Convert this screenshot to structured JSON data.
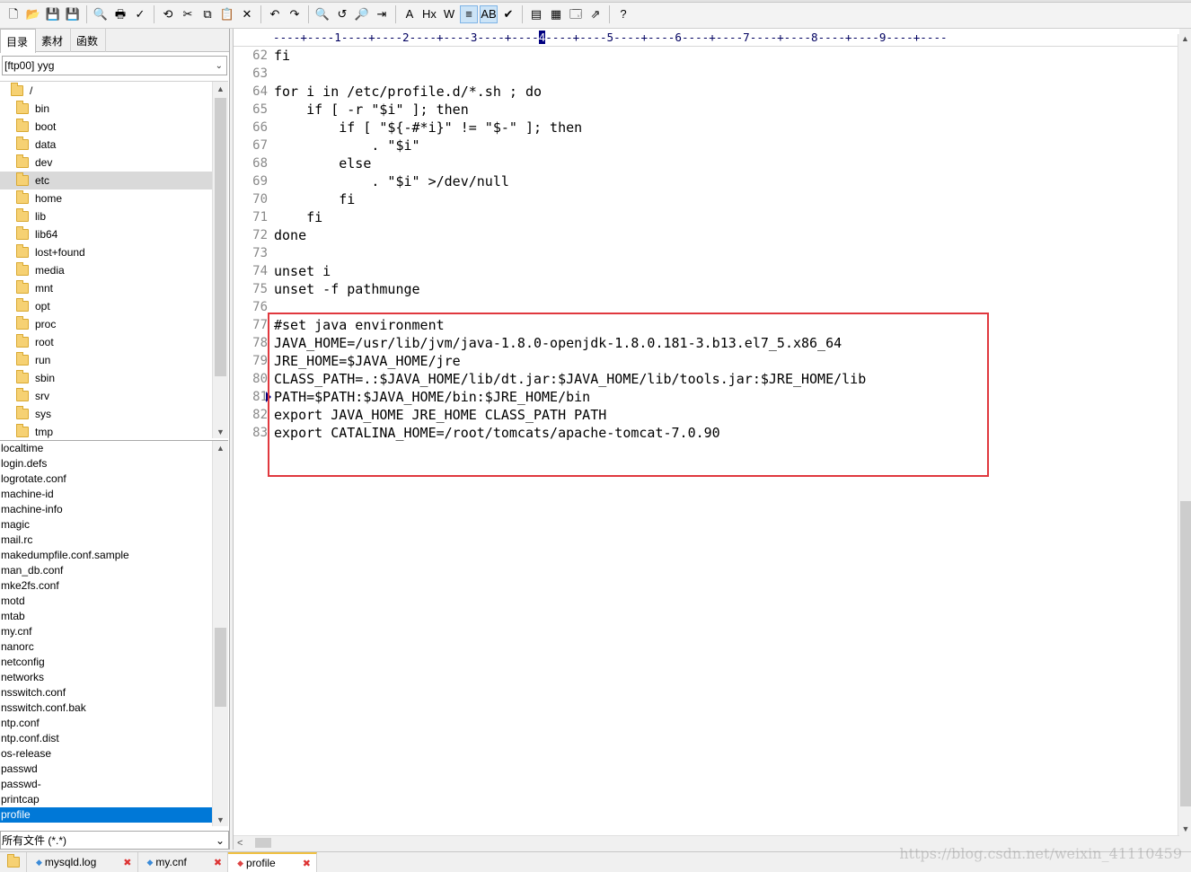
{
  "toolbar": {
    "icons": [
      "new-file-icon",
      "open-folder-icon",
      "save-icon",
      "save-all-icon",
      "print-preview-icon",
      "print-icon",
      "spell-check-icon",
      "format-icon",
      "cut-icon",
      "copy-icon",
      "paste-icon",
      "delete-icon",
      "undo-icon",
      "redo-icon",
      "find-icon",
      "replace-icon",
      "find-in-files-icon",
      "goto-icon",
      "font-icon",
      "hex-icon",
      "word-wrap-icon",
      "column-mode-icon",
      "abc-sort-icon",
      "check-icon",
      "view-icon",
      "layout-icon",
      "window-icon",
      "maximize-icon",
      "help-icon"
    ],
    "glyphs": [
      "🗋",
      "📂",
      "💾",
      "💾",
      "🔍",
      "🖶",
      "✓",
      "⟲",
      "✂",
      "⧉",
      "📋",
      "✕",
      "↶",
      "↷",
      "🔍",
      "↺",
      "🔎",
      "⇥",
      "A",
      "Hx",
      "W",
      "≡",
      "AB",
      "✔",
      "▤",
      "▦",
      "🗔",
      "⇗",
      "?"
    ]
  },
  "left_panel": {
    "tabs": [
      {
        "label": "目录"
      },
      {
        "label": "素材"
      },
      {
        "label": "函数"
      }
    ],
    "site": "[ftp00] yyg",
    "tree": [
      {
        "label": "/"
      },
      {
        "label": "bin"
      },
      {
        "label": "boot"
      },
      {
        "label": "data"
      },
      {
        "label": "dev"
      },
      {
        "label": "etc"
      },
      {
        "label": "home"
      },
      {
        "label": "lib"
      },
      {
        "label": "lib64"
      },
      {
        "label": "lost+found"
      },
      {
        "label": "media"
      },
      {
        "label": "mnt"
      },
      {
        "label": "opt"
      },
      {
        "label": "proc"
      },
      {
        "label": "root"
      },
      {
        "label": "run"
      },
      {
        "label": "sbin"
      },
      {
        "label": "srv"
      },
      {
        "label": "sys"
      },
      {
        "label": "tmp"
      }
    ],
    "files": [
      {
        "label": "localtime"
      },
      {
        "label": "login.defs"
      },
      {
        "label": "logrotate.conf"
      },
      {
        "label": "machine-id"
      },
      {
        "label": "machine-info"
      },
      {
        "label": "magic"
      },
      {
        "label": "mail.rc"
      },
      {
        "label": "makedumpfile.conf.sample"
      },
      {
        "label": "man_db.conf"
      },
      {
        "label": "mke2fs.conf"
      },
      {
        "label": "motd"
      },
      {
        "label": "mtab"
      },
      {
        "label": "my.cnf"
      },
      {
        "label": "nanorc"
      },
      {
        "label": "netconfig"
      },
      {
        "label": "networks"
      },
      {
        "label": "nsswitch.conf"
      },
      {
        "label": "nsswitch.conf.bak"
      },
      {
        "label": "ntp.conf"
      },
      {
        "label": "ntp.conf.dist"
      },
      {
        "label": "os-release"
      },
      {
        "label": "passwd"
      },
      {
        "label": "passwd-"
      },
      {
        "label": "printcap"
      },
      {
        "label": "profile"
      }
    ],
    "filter": "所有文件 (*.*)"
  },
  "editor": {
    "ruler": "----+----1----+----2----+----3----+----",
    "ruler_cursor": "4",
    "ruler_rest": "----+----5----+----6----+----7----+----8----+----9----+----",
    "lines": [
      {
        "num": "62",
        "text": "fi"
      },
      {
        "num": "63",
        "text": ""
      },
      {
        "num": "64",
        "text": "for i in /etc/profile.d/*.sh ; do"
      },
      {
        "num": "65",
        "text": "    if [ -r \"$i\" ]; then"
      },
      {
        "num": "66",
        "text": "        if [ \"${-#*i}\" != \"$-\" ]; then"
      },
      {
        "num": "67",
        "text": "            . \"$i\""
      },
      {
        "num": "68",
        "text": "        else"
      },
      {
        "num": "69",
        "text": "            . \"$i\" >/dev/null"
      },
      {
        "num": "70",
        "text": "        fi"
      },
      {
        "num": "71",
        "text": "    fi"
      },
      {
        "num": "72",
        "text": "done"
      },
      {
        "num": "73",
        "text": ""
      },
      {
        "num": "74",
        "text": "unset i"
      },
      {
        "num": "75",
        "text": "unset -f pathmunge"
      },
      {
        "num": "76",
        "text": ""
      },
      {
        "num": "77",
        "text": "#set java environment"
      },
      {
        "num": "78",
        "text": "JAVA_HOME=/usr/lib/jvm/java-1.8.0-openjdk-1.8.0.181-3.b13.el7_5.x86_64"
      },
      {
        "num": "79",
        "text": "JRE_HOME=$JAVA_HOME/jre"
      },
      {
        "num": "80",
        "text": "CLASS_PATH=.:$JAVA_HOME/lib/dt.jar:$JAVA_HOME/lib/tools.jar:$JRE_HOME/lib"
      },
      {
        "num": "81",
        "text": "PATH=$PATH:$JAVA_HOME/bin:$JRE_HOME/bin"
      },
      {
        "num": "82",
        "text": "export JAVA_HOME JRE_HOME CLASS_PATH PATH"
      },
      {
        "num": "83",
        "text": "export CATALINA_HOME=/root/tomcats/apache-tomcat-7.0.90"
      }
    ]
  },
  "file_tabs": [
    {
      "label": "mysqld.log"
    },
    {
      "label": "my.cnf"
    },
    {
      "label": "profile"
    }
  ],
  "watermark": "https://blog.csdn.net/weixin_41110459",
  "colors": {
    "selection": "#0078d7",
    "highlight_box": "#e0383e",
    "line_number": "#8a8a8a"
  }
}
